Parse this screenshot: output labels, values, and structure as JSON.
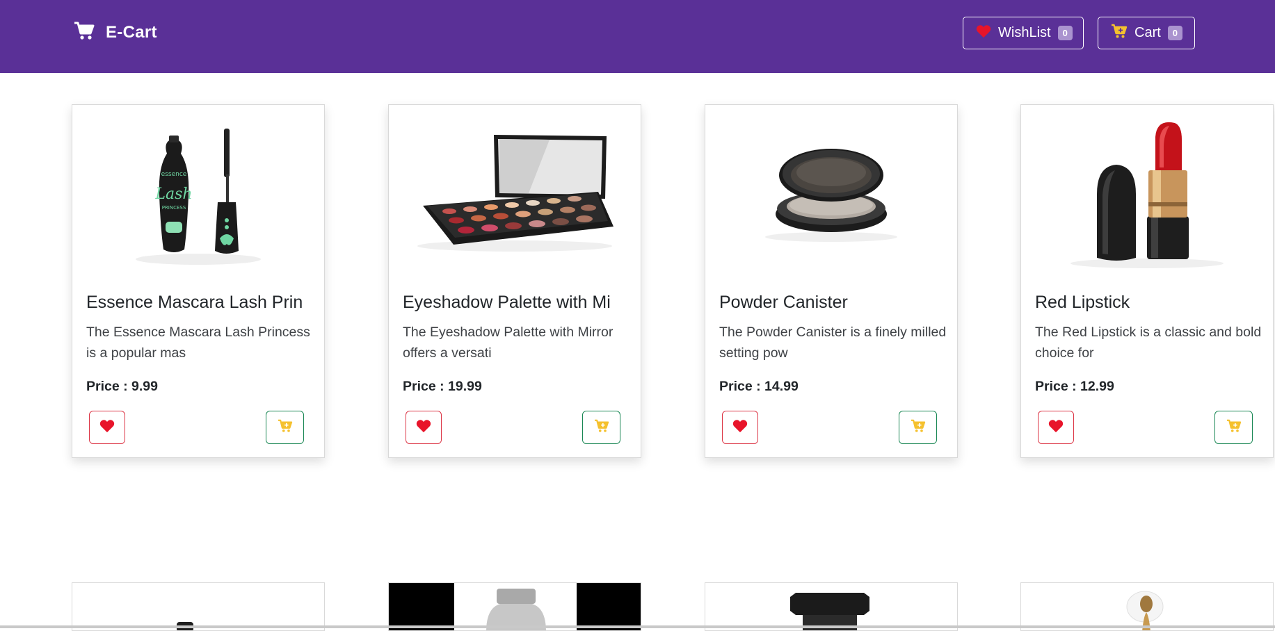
{
  "navbar": {
    "brand": "E-Cart",
    "wishlist_label": "WishList",
    "wishlist_count": "0",
    "cart_label": "Cart",
    "cart_count": "0"
  },
  "colors": {
    "navbar_bg": "#5a3097",
    "heart": "#e8142a",
    "cart_icon": "#f5c12e",
    "like_border": "#dc3545",
    "cart_border": "#198754"
  },
  "products": [
    {
      "title": "Essence Mascara Lash Prin",
      "description": "The Essence Mascara Lash Princess is a popular mas",
      "price": "Price : 9.99"
    },
    {
      "title": "Eyeshadow Palette with Mi",
      "description": "The Eyeshadow Palette with Mirror offers a versati",
      "price": "Price : 19.99"
    },
    {
      "title": "Powder Canister",
      "description": "The Powder Canister is a finely milled setting pow",
      "price": "Price : 14.99"
    },
    {
      "title": "Red Lipstick",
      "description": "The Red Lipstick is a classic and bold choice for",
      "price": "Price : 12.99"
    }
  ]
}
